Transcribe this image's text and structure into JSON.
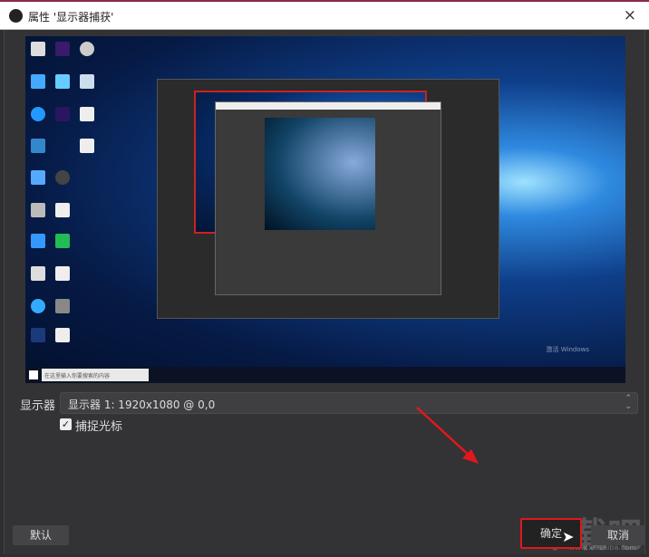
{
  "window": {
    "title": "属性 '显示器捕获'",
    "close_icon": "×"
  },
  "preview": {
    "search_placeholder": "在这里输入你要搜索的内容",
    "watermark_text": "激活 Windows"
  },
  "form": {
    "monitor_label": "显示器",
    "monitor_value": "显示器 1: 1920x1080 @ 0,0",
    "capture_cursor_label": "捕捉光标",
    "capture_cursor_checked": true
  },
  "buttons": {
    "defaults": "默认",
    "ok": "确定",
    "cancel": "取消"
  },
  "watermark": {
    "logo": "下载吧",
    "url": "www.xiazaiba.com"
  },
  "colors": {
    "highlight": "#e0181b",
    "arrow": "#e0181b"
  }
}
